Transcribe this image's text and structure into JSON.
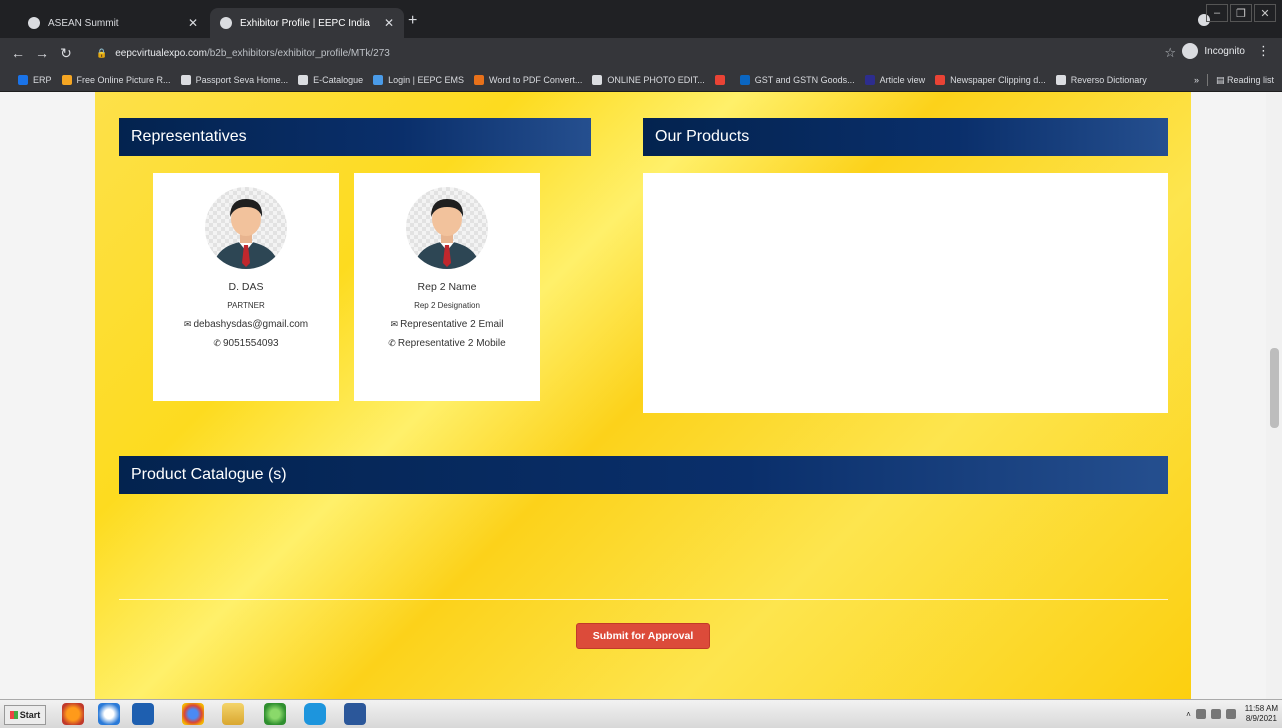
{
  "browser": {
    "tabs": [
      {
        "title": "ASEAN Summit",
        "active": false
      },
      {
        "title": "Exhibitor Profile | EEPC India",
        "active": true
      }
    ],
    "address": {
      "domain": "eepcvirtualexpo.com",
      "path": "/b2b_exhibitors/exhibitor_profile/MTk/273"
    },
    "profile_label": "Incognito",
    "bookmarks": [
      {
        "label": "ERP",
        "color": "#1a73e8"
      },
      {
        "label": "Free Online Picture R...",
        "color": "#f5a623"
      },
      {
        "label": "Passport Seva Home...",
        "color": "#dadce0"
      },
      {
        "label": "E-Catalogue",
        "color": "#dadce0"
      },
      {
        "label": "Login | EEPC EMS",
        "color": "#4a9be8"
      },
      {
        "label": "Word to PDF Convert...",
        "color": "#e8711a"
      },
      {
        "label": "ONLINE PHOTO EDIT...",
        "color": "#dadce0"
      },
      {
        "label": "",
        "color": "#ea4335"
      },
      {
        "label": "GST and GSTN Goods...",
        "color": "#0a66c2"
      },
      {
        "label": "Article view",
        "color": "#2d2d8e"
      },
      {
        "label": "Newspaper Clipping d...",
        "color": "#ea4335"
      },
      {
        "label": "Reverso Dictionary",
        "color": "#dadce0"
      }
    ],
    "reading_list": "Reading list"
  },
  "page": {
    "representatives_heading": "Representatives",
    "products_heading": "Our Products",
    "catalogue_heading": "Product Catalogue (s)",
    "representatives": [
      {
        "name": "D. DAS",
        "designation": "PARTNER",
        "email": "debashysdas@gmail.com",
        "phone": "9051554093"
      },
      {
        "name": "Rep 2 Name",
        "designation": "Rep 2 Designation",
        "email": "Representative 2 Email",
        "phone": "Representative 2 Mobile"
      }
    ],
    "submit_label": "Submit for Approval"
  },
  "taskbar": {
    "start_label": "Start",
    "time": "11:58 AM",
    "date": "8/9/2021"
  },
  "colors": {
    "header_navy": "#03234f",
    "page_yellow": "#fddb1f",
    "submit_red": "#dc4b3a"
  }
}
